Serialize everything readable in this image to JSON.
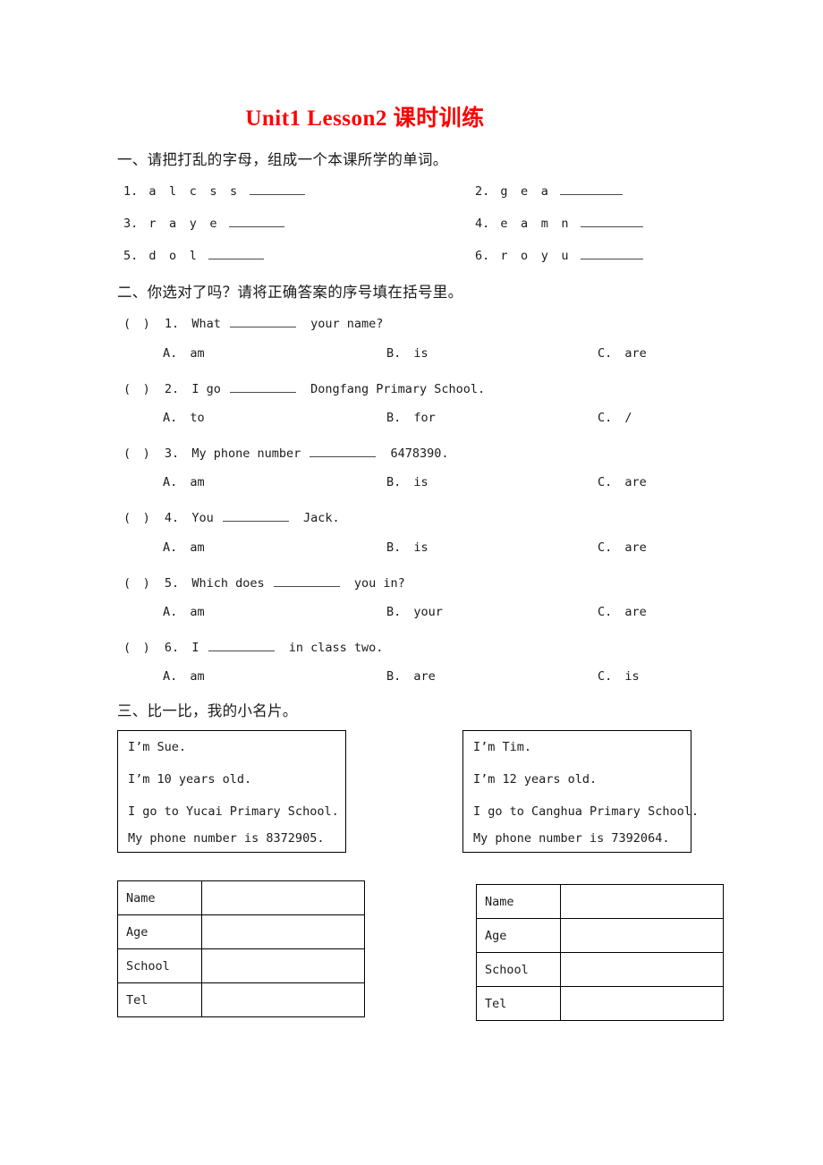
{
  "document": {
    "title": "Unit1 Lesson2 课时训练",
    "title_color": "#ff0000"
  },
  "section_one": {
    "heading": "一、请把打乱的字母，组成一个本课所学的单词。",
    "items": [
      {
        "number": "1.",
        "letters": "a l c s s"
      },
      {
        "number": "2.",
        "letters": "g e a"
      },
      {
        "number": "3.",
        "letters": "r a y e"
      },
      {
        "number": "4.",
        "letters": "e a m n"
      },
      {
        "number": "5.",
        "letters": "d o l"
      },
      {
        "number": "6.",
        "letters": "r o y u"
      }
    ]
  },
  "section_two": {
    "heading": "二、你选对了吗？请将正确答案的序号填在括号里。",
    "bracket": "(　)",
    "questions": [
      {
        "number": "1.",
        "stem_before": "What",
        "stem_after": "your name?",
        "options": [
          {
            "letter": "A.",
            "text": "am"
          },
          {
            "letter": "B.",
            "text": "is"
          },
          {
            "letter": "C.",
            "text": "are"
          }
        ]
      },
      {
        "number": "2.",
        "stem_before": "I go",
        "stem_after": "Dongfang Primary School.",
        "options": [
          {
            "letter": "A.",
            "text": "to"
          },
          {
            "letter": "B.",
            "text": "for"
          },
          {
            "letter": "C.",
            "text": "/"
          }
        ]
      },
      {
        "number": "3.",
        "stem_before": "My phone number",
        "stem_after": "6478390.",
        "options": [
          {
            "letter": "A.",
            "text": "am"
          },
          {
            "letter": "B.",
            "text": "is"
          },
          {
            "letter": "C.",
            "text": "are"
          }
        ]
      },
      {
        "number": "4.",
        "stem_before": "You",
        "stem_after": "Jack.",
        "options": [
          {
            "letter": "A.",
            "text": "am"
          },
          {
            "letter": "B.",
            "text": "is"
          },
          {
            "letter": "C.",
            "text": "are"
          }
        ]
      },
      {
        "number": "5.",
        "stem_before": "Which does",
        "stem_after": "you in?",
        "options": [
          {
            "letter": "A.",
            "text": "am"
          },
          {
            "letter": "B.",
            "text": "your"
          },
          {
            "letter": "C.",
            "text": "are"
          }
        ]
      },
      {
        "number": "6.",
        "stem_before": "I",
        "stem_after": "in class two.",
        "options": [
          {
            "letter": "A.",
            "text": "am"
          },
          {
            "letter": "B.",
            "text": "are"
          },
          {
            "letter": "C.",
            "text": "is"
          }
        ]
      }
    ]
  },
  "section_three": {
    "heading": "三、比一比，我的小名片。",
    "cards": [
      {
        "lines": [
          "I’m Sue.",
          "I’m 10 years old.",
          "I go to Yucai Primary School.",
          "My phone number is 8372905."
        ]
      },
      {
        "lines": [
          "I’m Tim.",
          "I’m 12 years old.",
          "I go to Canghua Primary School.",
          "My phone number is 7392064."
        ]
      }
    ],
    "tables": [
      {
        "rows": [
          {
            "label": "Name",
            "value": ""
          },
          {
            "label": "Age",
            "value": ""
          },
          {
            "label": "School",
            "value": ""
          },
          {
            "label": "Tel",
            "value": ""
          }
        ]
      },
      {
        "rows": [
          {
            "label": "Name",
            "value": ""
          },
          {
            "label": "Age",
            "value": ""
          },
          {
            "label": "School",
            "value": ""
          },
          {
            "label": "Tel",
            "value": ""
          }
        ]
      }
    ]
  }
}
